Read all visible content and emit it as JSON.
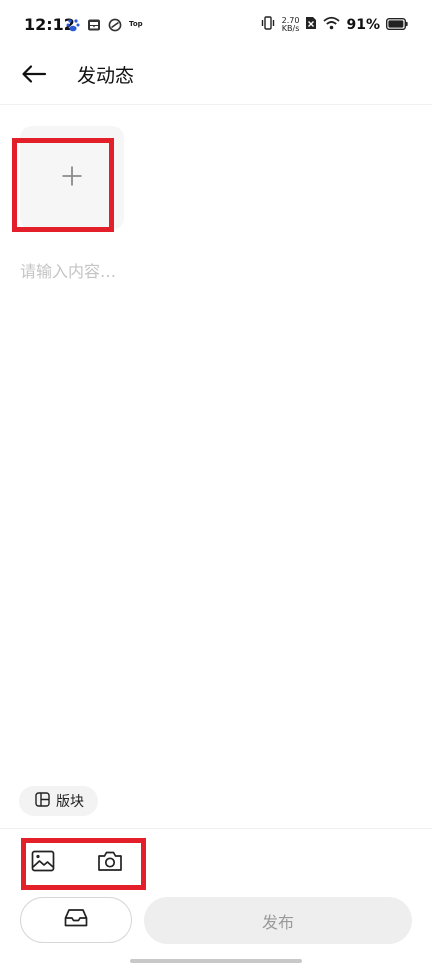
{
  "status_bar": {
    "time": "12:12",
    "top_badge": "Top",
    "net_speed_value": "2.70",
    "net_speed_unit": "KB/s",
    "battery_percent": "91%"
  },
  "header": {
    "title": "发动态",
    "back_icon": "arrow-left-icon"
  },
  "editor": {
    "add_image_icon": "plus-icon",
    "content_placeholder": "请输入内容…",
    "content_value": ""
  },
  "section_chip": {
    "label": "版块",
    "icon": "layout-icon"
  },
  "toolbar": {
    "image_icon": "image-icon",
    "camera_icon": "camera-icon"
  },
  "actions": {
    "drafts_icon": "inbox-icon",
    "publish_label": "发布"
  },
  "colors": {
    "highlight": "#e3202a",
    "publish_bg": "#eeeeee",
    "publish_text": "#9a9a9a",
    "placeholder": "#c4c4c4"
  }
}
